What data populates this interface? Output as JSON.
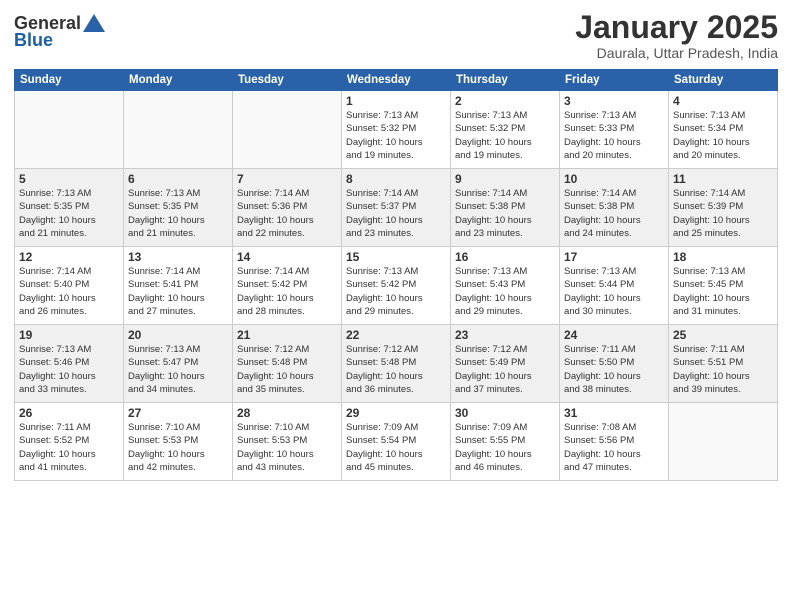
{
  "header": {
    "logo_line1": "General",
    "logo_line2": "Blue",
    "title": "January 2025",
    "subtitle": "Daurala, Uttar Pradesh, India"
  },
  "days_of_week": [
    "Sunday",
    "Monday",
    "Tuesday",
    "Wednesday",
    "Thursday",
    "Friday",
    "Saturday"
  ],
  "weeks": [
    {
      "days": [
        {
          "num": "",
          "info": ""
        },
        {
          "num": "",
          "info": ""
        },
        {
          "num": "",
          "info": ""
        },
        {
          "num": "1",
          "info": "Sunrise: 7:13 AM\nSunset: 5:32 PM\nDaylight: 10 hours\nand 19 minutes."
        },
        {
          "num": "2",
          "info": "Sunrise: 7:13 AM\nSunset: 5:32 PM\nDaylight: 10 hours\nand 19 minutes."
        },
        {
          "num": "3",
          "info": "Sunrise: 7:13 AM\nSunset: 5:33 PM\nDaylight: 10 hours\nand 20 minutes."
        },
        {
          "num": "4",
          "info": "Sunrise: 7:13 AM\nSunset: 5:34 PM\nDaylight: 10 hours\nand 20 minutes."
        }
      ]
    },
    {
      "days": [
        {
          "num": "5",
          "info": "Sunrise: 7:13 AM\nSunset: 5:35 PM\nDaylight: 10 hours\nand 21 minutes."
        },
        {
          "num": "6",
          "info": "Sunrise: 7:13 AM\nSunset: 5:35 PM\nDaylight: 10 hours\nand 21 minutes."
        },
        {
          "num": "7",
          "info": "Sunrise: 7:14 AM\nSunset: 5:36 PM\nDaylight: 10 hours\nand 22 minutes."
        },
        {
          "num": "8",
          "info": "Sunrise: 7:14 AM\nSunset: 5:37 PM\nDaylight: 10 hours\nand 23 minutes."
        },
        {
          "num": "9",
          "info": "Sunrise: 7:14 AM\nSunset: 5:38 PM\nDaylight: 10 hours\nand 23 minutes."
        },
        {
          "num": "10",
          "info": "Sunrise: 7:14 AM\nSunset: 5:38 PM\nDaylight: 10 hours\nand 24 minutes."
        },
        {
          "num": "11",
          "info": "Sunrise: 7:14 AM\nSunset: 5:39 PM\nDaylight: 10 hours\nand 25 minutes."
        }
      ]
    },
    {
      "days": [
        {
          "num": "12",
          "info": "Sunrise: 7:14 AM\nSunset: 5:40 PM\nDaylight: 10 hours\nand 26 minutes."
        },
        {
          "num": "13",
          "info": "Sunrise: 7:14 AM\nSunset: 5:41 PM\nDaylight: 10 hours\nand 27 minutes."
        },
        {
          "num": "14",
          "info": "Sunrise: 7:14 AM\nSunset: 5:42 PM\nDaylight: 10 hours\nand 28 minutes."
        },
        {
          "num": "15",
          "info": "Sunrise: 7:13 AM\nSunset: 5:42 PM\nDaylight: 10 hours\nand 29 minutes."
        },
        {
          "num": "16",
          "info": "Sunrise: 7:13 AM\nSunset: 5:43 PM\nDaylight: 10 hours\nand 29 minutes."
        },
        {
          "num": "17",
          "info": "Sunrise: 7:13 AM\nSunset: 5:44 PM\nDaylight: 10 hours\nand 30 minutes."
        },
        {
          "num": "18",
          "info": "Sunrise: 7:13 AM\nSunset: 5:45 PM\nDaylight: 10 hours\nand 31 minutes."
        }
      ]
    },
    {
      "days": [
        {
          "num": "19",
          "info": "Sunrise: 7:13 AM\nSunset: 5:46 PM\nDaylight: 10 hours\nand 33 minutes."
        },
        {
          "num": "20",
          "info": "Sunrise: 7:13 AM\nSunset: 5:47 PM\nDaylight: 10 hours\nand 34 minutes."
        },
        {
          "num": "21",
          "info": "Sunrise: 7:12 AM\nSunset: 5:48 PM\nDaylight: 10 hours\nand 35 minutes."
        },
        {
          "num": "22",
          "info": "Sunrise: 7:12 AM\nSunset: 5:48 PM\nDaylight: 10 hours\nand 36 minutes."
        },
        {
          "num": "23",
          "info": "Sunrise: 7:12 AM\nSunset: 5:49 PM\nDaylight: 10 hours\nand 37 minutes."
        },
        {
          "num": "24",
          "info": "Sunrise: 7:11 AM\nSunset: 5:50 PM\nDaylight: 10 hours\nand 38 minutes."
        },
        {
          "num": "25",
          "info": "Sunrise: 7:11 AM\nSunset: 5:51 PM\nDaylight: 10 hours\nand 39 minutes."
        }
      ]
    },
    {
      "days": [
        {
          "num": "26",
          "info": "Sunrise: 7:11 AM\nSunset: 5:52 PM\nDaylight: 10 hours\nand 41 minutes."
        },
        {
          "num": "27",
          "info": "Sunrise: 7:10 AM\nSunset: 5:53 PM\nDaylight: 10 hours\nand 42 minutes."
        },
        {
          "num": "28",
          "info": "Sunrise: 7:10 AM\nSunset: 5:53 PM\nDaylight: 10 hours\nand 43 minutes."
        },
        {
          "num": "29",
          "info": "Sunrise: 7:09 AM\nSunset: 5:54 PM\nDaylight: 10 hours\nand 45 minutes."
        },
        {
          "num": "30",
          "info": "Sunrise: 7:09 AM\nSunset: 5:55 PM\nDaylight: 10 hours\nand 46 minutes."
        },
        {
          "num": "31",
          "info": "Sunrise: 7:08 AM\nSunset: 5:56 PM\nDaylight: 10 hours\nand 47 minutes."
        },
        {
          "num": "",
          "info": ""
        }
      ]
    }
  ]
}
